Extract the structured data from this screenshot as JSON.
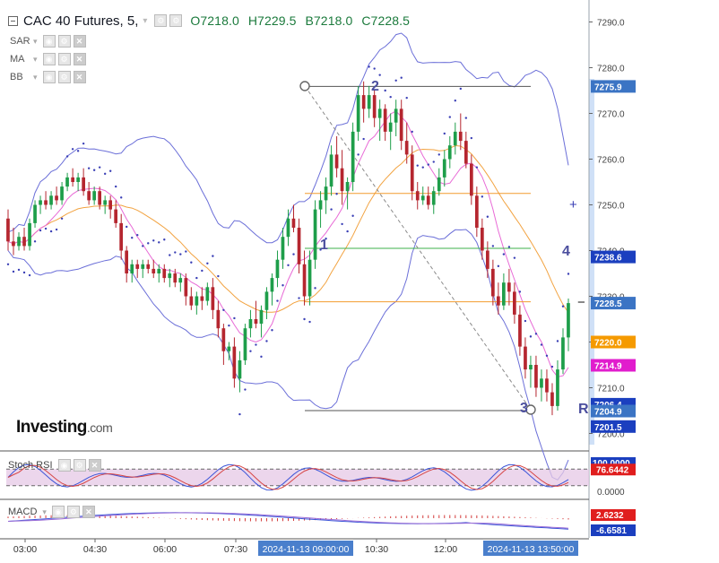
{
  "header": {
    "symbol": "CAC 40 Futures, 5,",
    "open": "O7218.0",
    "high": "H7229.5",
    "bid": "B7218.0",
    "close": "C7228.5",
    "ohlc_color": "#1b7a3c"
  },
  "indicators": [
    {
      "name": "SAR"
    },
    {
      "name": "MA"
    },
    {
      "name": "BB"
    }
  ],
  "logo": {
    "brand": "Investing",
    "suffix": ".com"
  },
  "panels": {
    "stoch_rsi": {
      "label": "Stoch RSI",
      "value_a": "100.0000",
      "value_b": "76.6442",
      "value_c": "0.0000"
    },
    "macd": {
      "label": "MACD",
      "value_a": "2.6232",
      "value_b": "-6.6581"
    }
  },
  "colors": {
    "up": "#1e9e4a",
    "down": "#b5262f",
    "bollinger": "#6b6fd8",
    "ma_orange": "#f2a341",
    "ma_pink": "#e86ad6",
    "sar": "#3a3fb5",
    "price_axis_bg": "#cfe0f7",
    "last_price": "#3b74c4",
    "hline_orange": "#f29b2e",
    "hline_green": "#3cb04b"
  },
  "chart_data": {
    "type": "candlestick",
    "y_axis": {
      "range": [
        7198,
        7293
      ],
      "ticks": [
        "7290.0",
        "7280.0",
        "7270.0",
        "7260.0",
        "7250.0",
        "7240.0",
        "7230.0",
        "7220.0",
        "7210.0",
        "7200.0"
      ]
    },
    "x_axis": {
      "ticks": [
        "03:00",
        "04:30",
        "06:00",
        "07:30",
        "2024-11-13 09:00:00",
        "10:30",
        "12:00",
        "2024-11-13 13:50:00"
      ]
    },
    "price_labels": [
      {
        "text": "7275.9",
        "value": 7275.9,
        "color": "#3b74c4"
      },
      {
        "text": "7238.6",
        "value": 7238.6,
        "color": "#1b3fbf"
      },
      {
        "text": "7228.5",
        "value": 7228.5,
        "color": "#3b74c4"
      },
      {
        "text": "7220.0",
        "value": 7220.0,
        "color": "#f59a00"
      },
      {
        "text": "7214.9",
        "value": 7214.9,
        "color": "#e11dcd"
      },
      {
        "text": "7206.4",
        "value": 7206.4,
        "color": "#1b3fbf"
      },
      {
        "text": "7204.9",
        "value": 7204.9,
        "color": "#3b74c4"
      },
      {
        "text": "7201.5",
        "value": 7201.5,
        "color": "#1b3fbf"
      }
    ],
    "drawings": {
      "wave_labels": [
        "1",
        "2",
        "3",
        "4",
        "R"
      ],
      "horizontal_levels": [
        {
          "value": 7275.9,
          "color": "#555555"
        },
        {
          "value": 7252.5,
          "color": "#f29b2e"
        },
        {
          "value": 7240.5,
          "color": "#3cb04b"
        },
        {
          "value": 7228.8,
          "color": "#f29b2e"
        },
        {
          "value": 7205.0,
          "color": "#555555"
        }
      ]
    },
    "candles_ohlc": [
      [
        7247,
        7249,
        7240,
        7242
      ],
      [
        7242,
        7245,
        7239,
        7241
      ],
      [
        7241,
        7244,
        7240,
        7243
      ],
      [
        7243,
        7245,
        7240,
        7241
      ],
      [
        7241,
        7247,
        7240,
        7246
      ],
      [
        7246,
        7251,
        7245,
        7250
      ],
      [
        7250,
        7252,
        7248,
        7251
      ],
      [
        7251,
        7253,
        7249,
        7250
      ],
      [
        7250,
        7253,
        7249,
        7252
      ],
      [
        7252,
        7254,
        7250,
        7251
      ],
      [
        7251,
        7255,
        7250,
        7254
      ],
      [
        7254,
        7257,
        7253,
        7256
      ],
      [
        7256,
        7258,
        7254,
        7255
      ],
      [
        7255,
        7257,
        7253,
        7256
      ],
      [
        7256,
        7258,
        7252,
        7253
      ],
      [
        7253,
        7255,
        7250,
        7251
      ],
      [
        7251,
        7254,
        7250,
        7253
      ],
      [
        7253,
        7254,
        7249,
        7250
      ],
      [
        7250,
        7252,
        7248,
        7251
      ],
      [
        7251,
        7252,
        7247,
        7249
      ],
      [
        7249,
        7251,
        7245,
        7246
      ],
      [
        7246,
        7248,
        7238,
        7240
      ],
      [
        7240,
        7241,
        7233,
        7235
      ],
      [
        7235,
        7238,
        7233,
        7237
      ],
      [
        7237,
        7238,
        7234,
        7236
      ],
      [
        7236,
        7238,
        7234,
        7237
      ],
      [
        7237,
        7238,
        7235,
        7236
      ],
      [
        7236,
        7238,
        7234,
        7235
      ],
      [
        7235,
        7237,
        7233,
        7236
      ],
      [
        7236,
        7237,
        7233,
        7234
      ],
      [
        7234,
        7236,
        7232,
        7235
      ],
      [
        7235,
        7236,
        7232,
        7233
      ],
      [
        7233,
        7235,
        7231,
        7234
      ],
      [
        7234,
        7235,
        7228,
        7230
      ],
      [
        7230,
        7232,
        7227,
        7228
      ],
      [
        7228,
        7231,
        7226,
        7230
      ],
      [
        7230,
        7232,
        7227,
        7229
      ],
      [
        7229,
        7233,
        7228,
        7232
      ],
      [
        7232,
        7234,
        7225,
        7227
      ],
      [
        7227,
        7229,
        7221,
        7223
      ],
      [
        7223,
        7224,
        7215,
        7218
      ],
      [
        7218,
        7220,
        7216,
        7219
      ],
      [
        7219,
        7221,
        7210,
        7212
      ],
      [
        7212,
        7218,
        7209,
        7216
      ],
      [
        7216,
        7224,
        7215,
        7223
      ],
      [
        7223,
        7227,
        7221,
        7225
      ],
      [
        7225,
        7229,
        7223,
        7224
      ],
      [
        7224,
        7228,
        7221,
        7227
      ],
      [
        7227,
        7232,
        7225,
        7231
      ],
      [
        7231,
        7235,
        7228,
        7234
      ],
      [
        7234,
        7240,
        7232,
        7238
      ],
      [
        7238,
        7245,
        7236,
        7243
      ],
      [
        7243,
        7249,
        7241,
        7247
      ],
      [
        7247,
        7250,
        7244,
        7245
      ],
      [
        7245,
        7247,
        7235,
        7237
      ],
      [
        7237,
        7240,
        7228,
        7230
      ],
      [
        7230,
        7240,
        7228,
        7238
      ],
      [
        7238,
        7251,
        7236,
        7249
      ],
      [
        7249,
        7253,
        7245,
        7251
      ],
      [
        7251,
        7256,
        7248,
        7254
      ],
      [
        7254,
        7263,
        7252,
        7261
      ],
      [
        7261,
        7265,
        7256,
        7258
      ],
      [
        7258,
        7262,
        7250,
        7253
      ],
      [
        7253,
        7256,
        7249,
        7255
      ],
      [
        7255,
        7268,
        7253,
        7266
      ],
      [
        7266,
        7276,
        7264,
        7274
      ],
      [
        7274,
        7277,
        7268,
        7271
      ],
      [
        7271,
        7276,
        7269,
        7274
      ],
      [
        7274,
        7275,
        7267,
        7269
      ],
      [
        7269,
        7273,
        7264,
        7271
      ],
      [
        7271,
        7272,
        7264,
        7266
      ],
      [
        7266,
        7270,
        7262,
        7268
      ],
      [
        7268,
        7273,
        7265,
        7271
      ],
      [
        7271,
        7273,
        7262,
        7264
      ],
      [
        7264,
        7268,
        7259,
        7261
      ],
      [
        7261,
        7263,
        7251,
        7253
      ],
      [
        7253,
        7255,
        7249,
        7251
      ],
      [
        7251,
        7254,
        7250,
        7252
      ],
      [
        7252,
        7254,
        7249,
        7250
      ],
      [
        7250,
        7254,
        7248,
        7253
      ],
      [
        7253,
        7258,
        7252,
        7256
      ],
      [
        7256,
        7262,
        7254,
        7260
      ],
      [
        7260,
        7265,
        7258,
        7263
      ],
      [
        7263,
        7268,
        7261,
        7266
      ],
      [
        7266,
        7270,
        7262,
        7264
      ],
      [
        7264,
        7266,
        7258,
        7259
      ],
      [
        7259,
        7261,
        7250,
        7252
      ],
      [
        7252,
        7254,
        7243,
        7245
      ],
      [
        7245,
        7247,
        7238,
        7240
      ],
      [
        7240,
        7242,
        7234,
        7236
      ],
      [
        7236,
        7238,
        7228,
        7230
      ],
      [
        7230,
        7233,
        7226,
        7228
      ],
      [
        7228,
        7235,
        7227,
        7233
      ],
      [
        7233,
        7236,
        7228,
        7231
      ],
      [
        7231,
        7233,
        7224,
        7226
      ],
      [
        7226,
        7228,
        7217,
        7219
      ],
      [
        7219,
        7221,
        7212,
        7214
      ],
      [
        7214,
        7217,
        7210,
        7215
      ],
      [
        7215,
        7217,
        7208,
        7210
      ],
      [
        7210,
        7214,
        7207,
        7212
      ],
      [
        7212,
        7214,
        7207,
        7209
      ],
      [
        7209,
        7211,
        7204,
        7206
      ],
      [
        7206,
        7216,
        7205,
        7214
      ],
      [
        7214,
        7223,
        7213,
        7221
      ],
      [
        7221,
        7229.5,
        7218,
        7228.5
      ]
    ],
    "stoch_rsi_range": [
      0,
      100
    ],
    "macd_range": [
      -8,
      4
    ]
  }
}
